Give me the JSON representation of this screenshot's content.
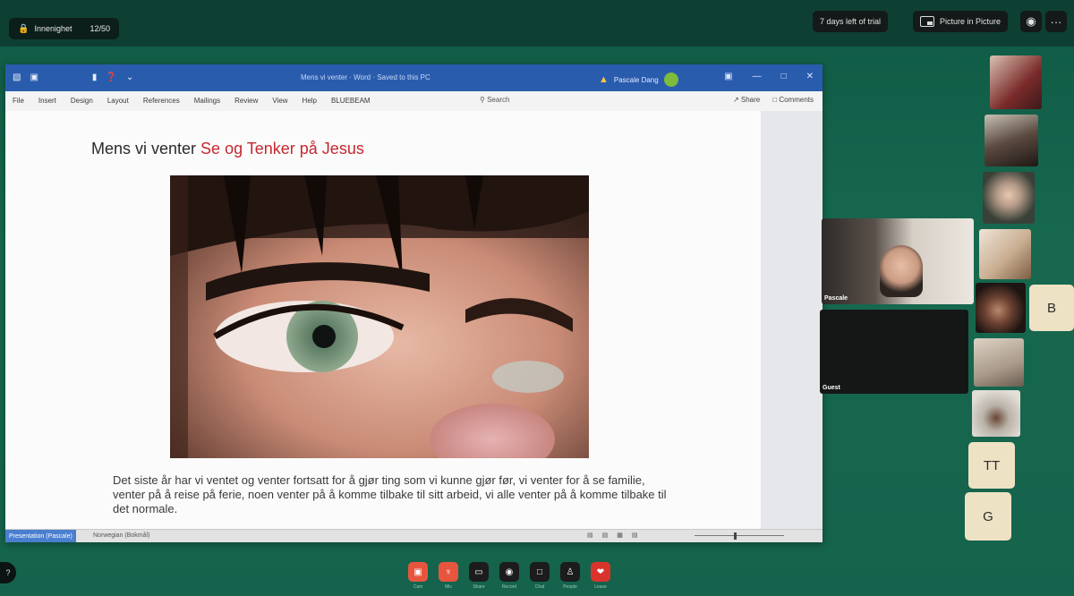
{
  "room": {
    "name": "Innenighet",
    "count": "12/50"
  },
  "topbar": {
    "trial_text": "7 days left of trial",
    "pip_label": "Picture in Picture",
    "record_icon": "record-icon",
    "more_label": "···"
  },
  "word": {
    "title": "Mens vi venter  ·  Word  ·  Saved to this PC",
    "user": "Pascale Dang",
    "tabs": [
      "File",
      "Insert",
      "Design",
      "Layout",
      "References",
      "Mailings",
      "Review",
      "View",
      "Help",
      "BLUEBEAM"
    ],
    "search_placeholder": "Search",
    "share_label": "Share",
    "comments_label": "Comments",
    "status_presenting": "Presentation (Pascale)",
    "status_words": "Norwegian (Bokmål)"
  },
  "document": {
    "heading_plain": "Mens vi venter ",
    "heading_red": "Se og Tenker på Jesus",
    "paragraph": "Det siste år har vi ventet og venter fortsatt for å gjør ting som vi kunne gjør før, vi venter for å se familie, venter på å reise på ferie, noen venter på å komme tilbake til sitt arbeid, vi alle venter på å komme tilbake til det normale."
  },
  "participants": {
    "pascale": "Pascale",
    "guest": "Guest",
    "letters": [
      "B",
      "TT",
      "G"
    ]
  },
  "controls": [
    {
      "icon": "camera-icon",
      "label": "Cam",
      "color": "#e8553f"
    },
    {
      "icon": "microphone-icon",
      "label": "Mic",
      "color": "#e8553f"
    },
    {
      "icon": "share-screen-icon",
      "label": "Share",
      "color": "#1c1c1c"
    },
    {
      "icon": "record-icon",
      "label": "Record",
      "color": "#1c1c1c"
    },
    {
      "icon": "chat-icon",
      "label": "Chat",
      "color": "#1c1c1c"
    },
    {
      "icon": "people-icon",
      "label": "People",
      "color": "#1c1c1c"
    },
    {
      "icon": "leave-icon",
      "label": "Leave",
      "color": "#d9342c"
    }
  ]
}
